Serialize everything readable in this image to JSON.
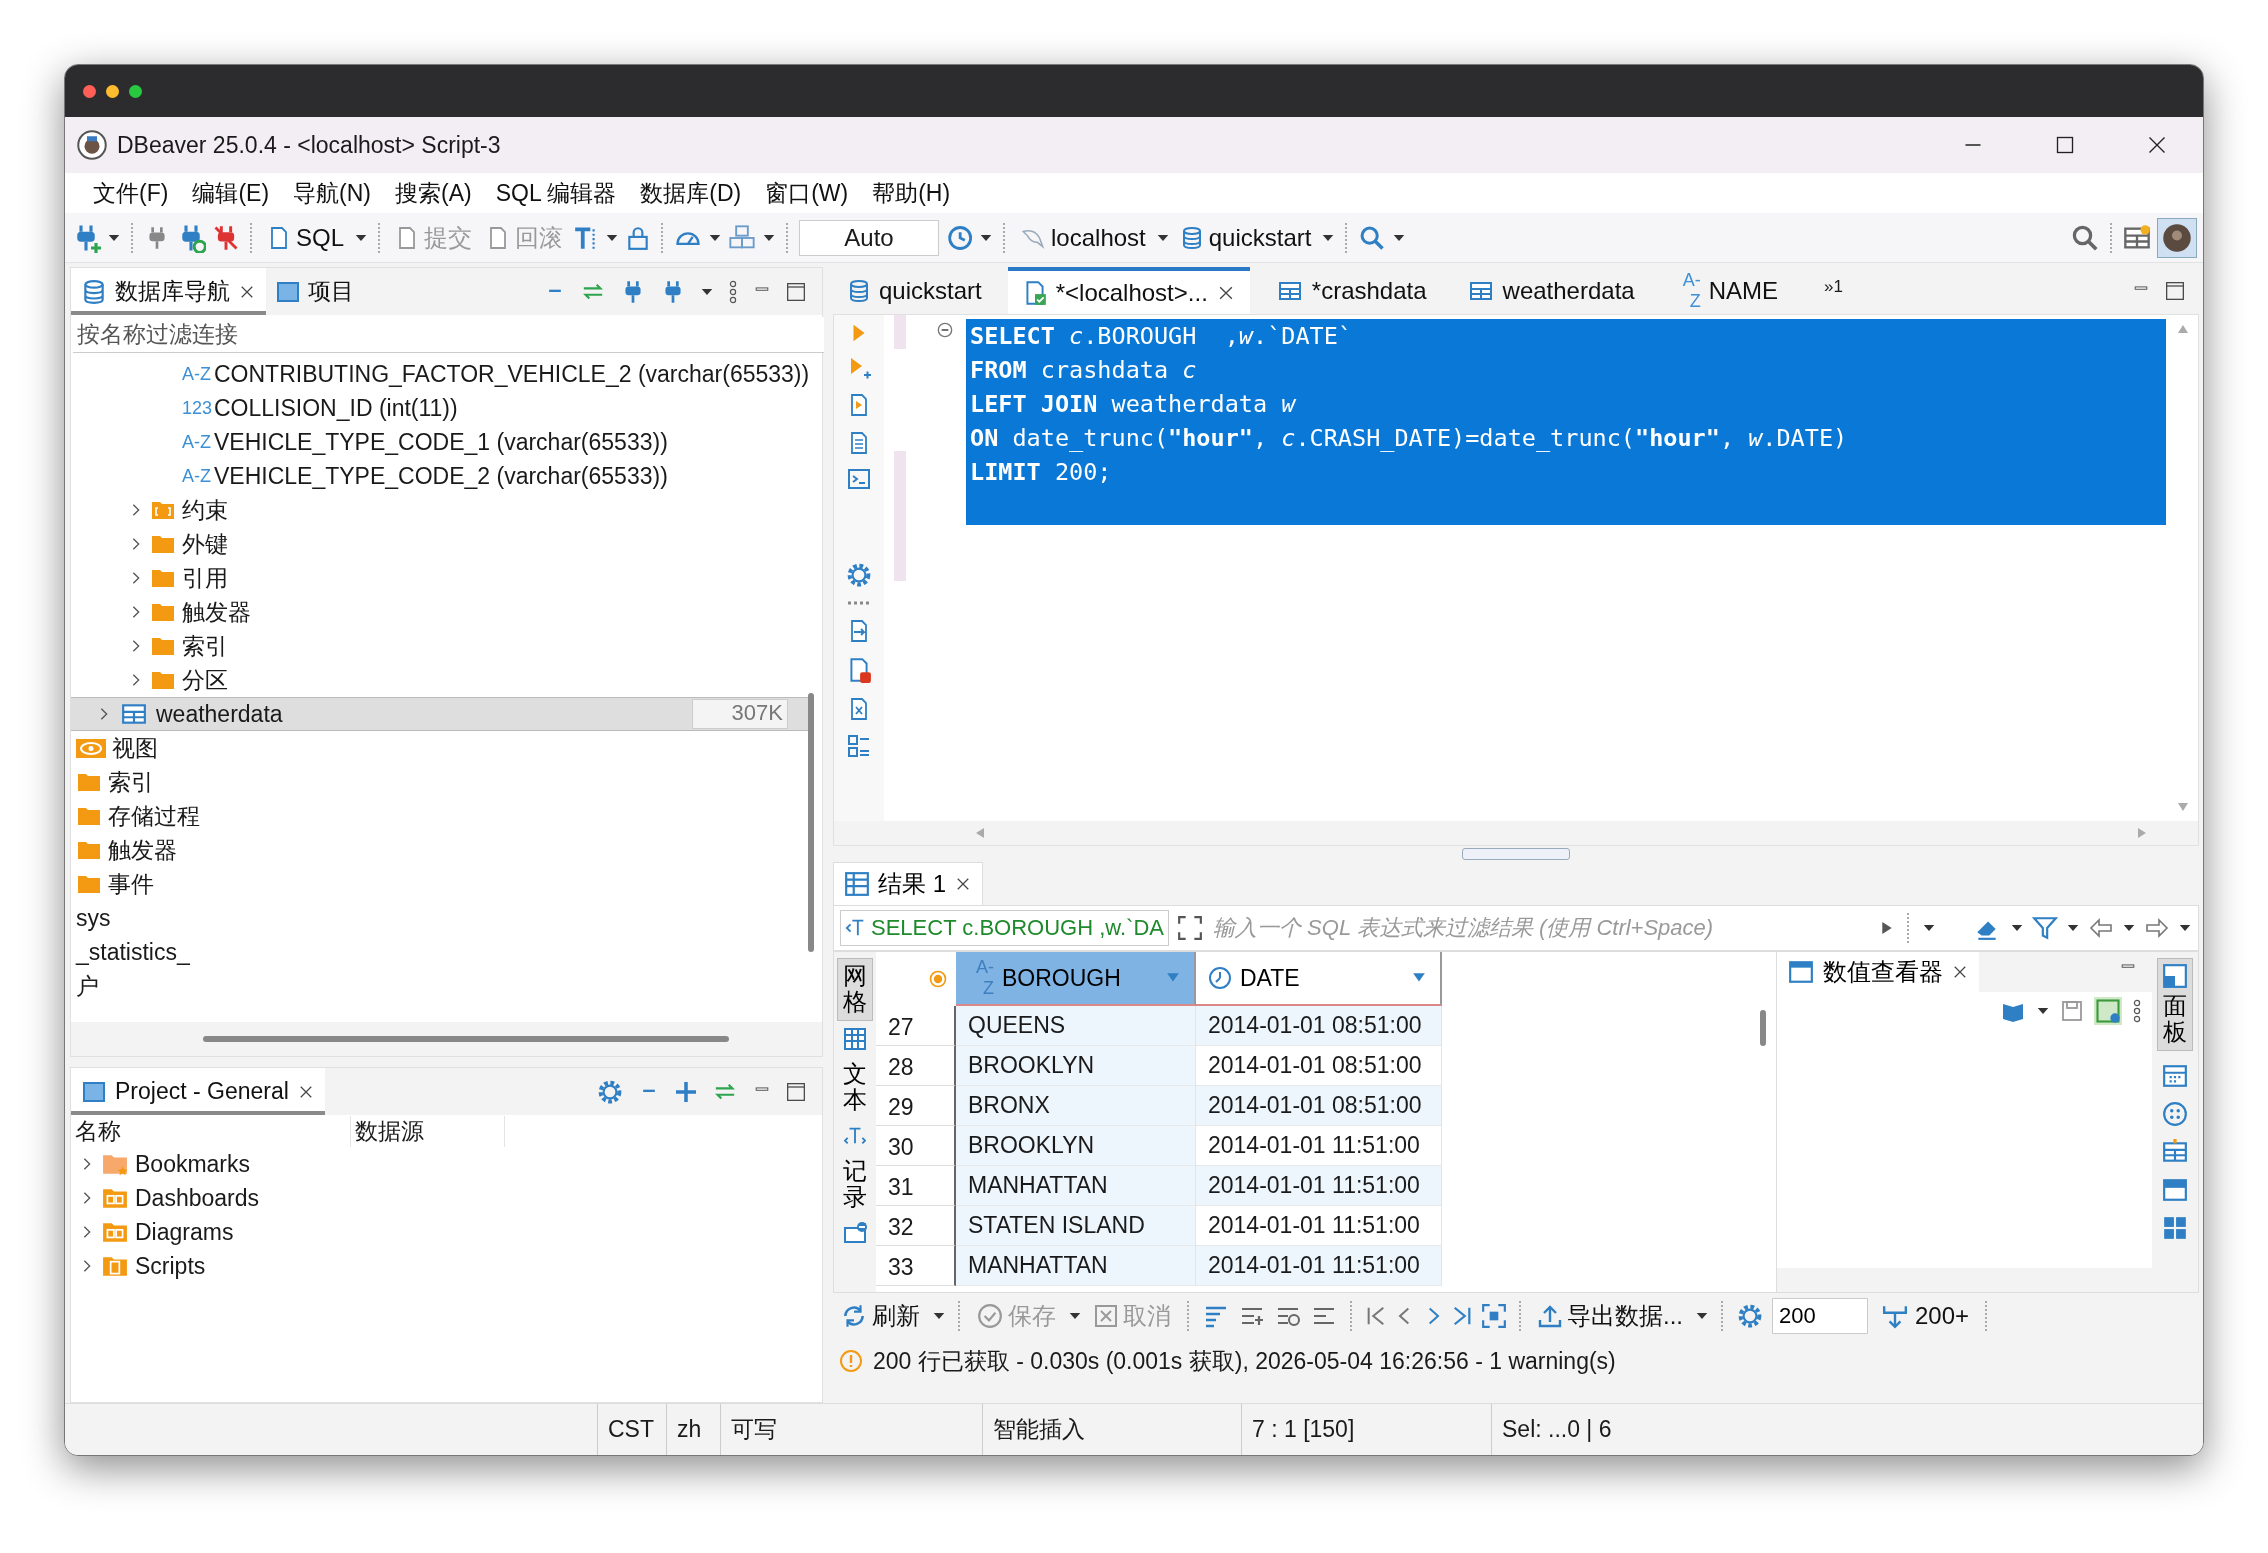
{
  "window": {
    "title": "DBeaver 25.0.4 - <localhost> Script-3"
  },
  "menu": [
    "文件(F)",
    "编辑(E)",
    "导航(N)",
    "搜索(A)",
    "SQL 编辑器",
    "数据库(D)",
    "窗口(W)",
    "帮助(H)"
  ],
  "toolbar": {
    "sql": "SQL",
    "commit": {
      "label": "提交",
      "disabled": true
    },
    "rollback": {
      "label": "回滚",
      "disabled": true
    },
    "mode": "Auto",
    "connection": "localhost",
    "database": "quickstart"
  },
  "navigator": {
    "tabs": [
      {
        "label": "数据库导航",
        "selected": true
      },
      {
        "label": "项目",
        "selected": false
      }
    ],
    "filter": {
      "placeholder": "按名称过滤连接"
    },
    "tree": [
      {
        "children": [
          {
            "children": [
              {
                "children": [
                  {
                    "label": "CONTRIBUTING_FACTOR_VEHICLE_2 (varchar(65533))",
                    "kind": "column",
                    "type": "A-Z",
                    "selected": false
                  },
                  {
                    "label": "COLLISION_ID (int(11))",
                    "kind": "column",
                    "type": "123",
                    "selected": false
                  },
                  {
                    "label": "VEHICLE_TYPE_CODE_1 (varchar(65533))",
                    "kind": "column",
                    "type": "A-Z",
                    "selected": false
                  },
                  {
                    "label": "VEHICLE_TYPE_CODE_2 (varchar(65533))",
                    "kind": "column",
                    "type": "A-Z",
                    "selected": false
                  }
                ]
              },
              {
                "label": "约束",
                "kind": "constraints",
                "expanded": false,
                "selected": false
              },
              {
                "label": "外键",
                "kind": "folder",
                "expanded": false,
                "selected": false
              },
              {
                "label": "引用",
                "kind": "folder",
                "expanded": false,
                "selected": false
              },
              {
                "label": "触发器",
                "kind": "folder",
                "expanded": false,
                "selected": false
              },
              {
                "label": "索引",
                "kind": "folder",
                "expanded": false,
                "selected": false
              },
              {
                "label": "分区",
                "kind": "folder",
                "expanded": false,
                "selected": false
              }
            ]
          },
          {
            "label": "weatherdata",
            "kind": "table",
            "expanded": false,
            "selected": true,
            "size": "307K"
          }
        ]
      },
      {
        "label": "视图",
        "kind": "view",
        "selected": false
      },
      {
        "label": "索引",
        "kind": "folder",
        "selected": false
      },
      {
        "label": "存储过程",
        "kind": "folder",
        "selected": false
      },
      {
        "label": "触发器",
        "kind": "folder",
        "selected": false
      },
      {
        "label": "事件",
        "kind": "folder",
        "selected": false
      },
      {
        "label": "sys",
        "kind": "plain",
        "selected": false
      },
      {
        "label": "_statistics_",
        "kind": "plain",
        "selected": false
      },
      {
        "label": "户",
        "kind": "plain",
        "selected": false
      }
    ]
  },
  "project": {
    "tab": "Project - General",
    "columns": [
      "名称",
      "数据源"
    ],
    "items": [
      {
        "label": "Bookmarks",
        "kind": "bookmarks"
      },
      {
        "label": "Dashboards",
        "kind": "dashboards"
      },
      {
        "label": "Diagrams",
        "kind": "diagrams"
      },
      {
        "label": "Scripts",
        "kind": "scripts"
      }
    ]
  },
  "editor": {
    "tabs": [
      {
        "label": "quickstart",
        "kind": "database",
        "selected": false,
        "closable": false
      },
      {
        "label": "*<localhost>...",
        "kind": "script",
        "selected": true,
        "closable": true
      },
      {
        "label": "*crashdata",
        "kind": "table",
        "selected": false,
        "closable": false
      },
      {
        "label": "weatherdata",
        "kind": "table",
        "selected": false,
        "closable": false
      },
      {
        "label": "NAME",
        "kind": "column",
        "type": "A-Z",
        "selected": false,
        "closable": false
      }
    ],
    "overflow_mark": "»",
    "overflow_count": "1",
    "code": {
      "selected": true,
      "lines": [
        "**SELECT** *c*.BOROUGH  ,*w*.`DATE`",
        "**FROM** crashdata *c*",
        "**LEFT JOIN** weatherdata *w*",
        "**ON** date_trunc(**\"hour\"**, *c*.CRASH_DATE)=date_trunc(**\"hour\"**, *w*.DATE)",
        "**LIMIT** 200;"
      ]
    }
  },
  "results": {
    "tab": "结果 1",
    "query": "SELECT c.BOROUGH ,w.`DA",
    "filter": {
      "placeholder": "输入一个 SQL 表达式来过滤结果 (使用 Ctrl+Space)"
    },
    "views": [
      {
        "label": "网格",
        "kind": "grid",
        "selected": true
      },
      {
        "label": "文本",
        "kind": "text",
        "selected": false
      },
      {
        "label": "记录",
        "kind": "record",
        "selected": false
      }
    ],
    "columns": [
      {
        "label": "BOROUGH",
        "kind": "string",
        "type": "A-Z",
        "selected": true
      },
      {
        "label": "DATE",
        "kind": "datetime",
        "selected": false
      }
    ],
    "rows": [
      {
        "num": "27",
        "cells": [
          "QUEENS",
          "2014-01-01 08:51:00"
        ]
      },
      {
        "num": "28",
        "cells": [
          "BROOKLYN",
          "2014-01-01 08:51:00"
        ]
      },
      {
        "num": "29",
        "cells": [
          "BRONX",
          "2014-01-01 08:51:00"
        ]
      },
      {
        "num": "30",
        "cells": [
          "BROOKLYN",
          "2014-01-01 11:51:00"
        ]
      },
      {
        "num": "31",
        "cells": [
          "MANHATTAN",
          "2014-01-01 11:51:00"
        ]
      },
      {
        "num": "32",
        "cells": [
          "STATEN ISLAND",
          "2014-01-01 11:51:00"
        ]
      },
      {
        "num": "33",
        "cells": [
          "MANHATTAN",
          "2014-01-01 11:51:00"
        ]
      }
    ],
    "value_viewer": {
      "title": "数值查看器"
    },
    "panels_tab": "面板",
    "actions": {
      "refresh": "刷新",
      "save": {
        "label": "保存",
        "disabled": true
      },
      "cancel": {
        "label": "取消",
        "disabled": true
      },
      "export": "导出数据...",
      "fetch_size": "200",
      "fetch_more": "200+"
    },
    "message": "200 行已获取 - 0.030s (0.001s 获取), 2026-05-04 16:26:56 - 1 warning(s)"
  },
  "status_bar": [
    "CST",
    "zh",
    "可写",
    "智能插入",
    "7 : 1 [150]",
    "Sel: ...0 | 6"
  ]
}
